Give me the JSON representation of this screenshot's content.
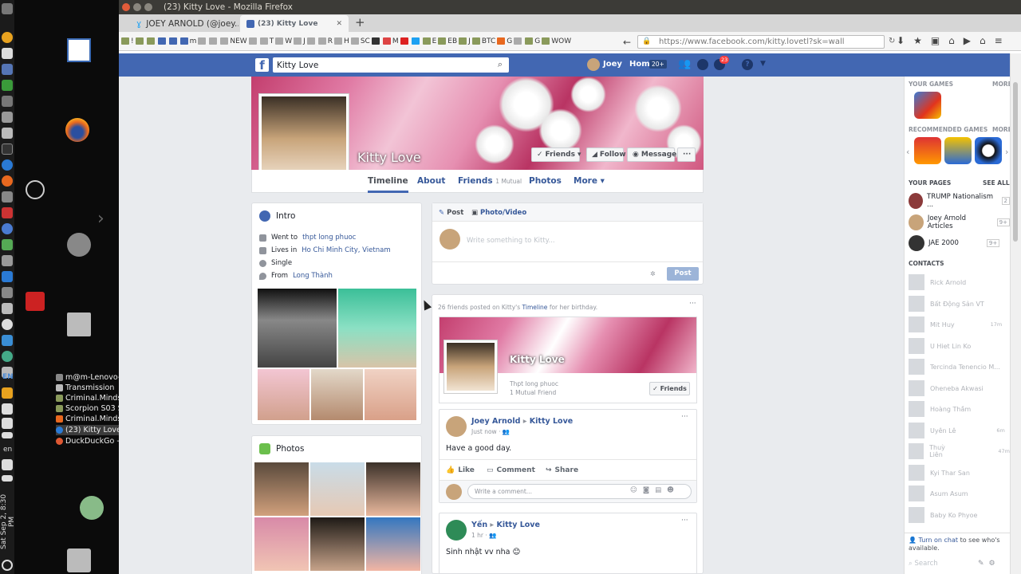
{
  "dock": {
    "lang": "EN",
    "lang2": "en",
    "clock": "Sat Sep 2, 8:30 PM"
  },
  "taskbar": [
    "m@m-Lenovo-...",
    "Transmission",
    "Criminal.Minds...",
    "Scorpion S03 S...",
    "Criminal.Minds...",
    "(23) Kitty Love ...",
    "DuckDuckGo - ..."
  ],
  "window": {
    "title": "(23) Kitty Love - Mozilla Firefox"
  },
  "tabs": [
    {
      "label": "JOEY ARNOLD (@joey..."
    },
    {
      "label": "(23) Kitty Love"
    }
  ],
  "bookmarks": [
    "!",
    "",
    "",
    "",
    "",
    "m",
    "",
    "",
    "NEW",
    "",
    "T",
    "W",
    "J",
    "",
    "R",
    "H",
    "SC",
    "",
    "M",
    "",
    "",
    "E",
    "EB",
    "J",
    "BTC",
    "G",
    "",
    "G",
    "WOW"
  ],
  "url": "https://www.facebook.com/kitty.lovetl?sk=wall",
  "fb": {
    "search_value": "Kitty Love",
    "user": "Joey",
    "home": "Home",
    "home_count": "20+",
    "notif_count": "23"
  },
  "profile": {
    "name": "Kitty Love",
    "buttons": {
      "friends": "Friends",
      "follow": "Follow",
      "message": "Message",
      "more": "···"
    },
    "nav": {
      "timeline": "Timeline",
      "about": "About",
      "friends": "Friends",
      "mutual": "1 Mutual",
      "photos": "Photos",
      "more": "More"
    }
  },
  "intro": {
    "title": "Intro",
    "went_pre": "Went to",
    "went": "thpt long phuoc",
    "lives_pre": "Lives in",
    "lives": "Ho Chi Minh City, Vietnam",
    "status": "Single",
    "from_pre": "From",
    "from": "Long Thành"
  },
  "photos": {
    "title": "Photos"
  },
  "composer": {
    "post": "Post",
    "photo": "Photo/Video",
    "placeholder": "Write something to Kitty...",
    "post_btn": "Post"
  },
  "birthday": {
    "pre": "26 friends posted on Kitty's",
    "timeline": "Timeline",
    "post": "for her birthday.",
    "name": "Kitty Love",
    "school": "Thpt long phuoc",
    "mutual": "1 Mutual Friend",
    "friends_btn": "Friends"
  },
  "post1": {
    "author": "Joey Arnold",
    "target": "Kitty Love",
    "time": "Just now",
    "text": "Have a good day.",
    "like": "Like",
    "comment": "Comment",
    "share": "Share",
    "comment_placeholder": "Write a comment..."
  },
  "post2": {
    "author": "Yến",
    "target": "Kitty Love",
    "time": "1 hr",
    "text": "Sinh nhật vv nha 😊"
  },
  "right": {
    "your_games": "YOUR GAMES",
    "more": "MORE",
    "recommended": "RECOMMENDED GAMES",
    "more2": "MORE",
    "your_pages": "YOUR PAGES",
    "see_all": "SEE ALL",
    "pages": [
      {
        "name": "TRUMP Nationalism ...",
        "count": "2"
      },
      {
        "name": "Joey Arnold Articles",
        "count": "9+"
      },
      {
        "name": "JAE 2000",
        "count": "9+"
      }
    ],
    "contacts_title": "CONTACTS",
    "contacts": [
      {
        "name": "Rick Arnold",
        "t": ""
      },
      {
        "name": "Bất Động Sản VT",
        "t": ""
      },
      {
        "name": "Mit Huy",
        "t": "17m"
      },
      {
        "name": "U Hiet Lin Ko",
        "t": ""
      },
      {
        "name": "Tercinda Tenencio M...",
        "t": ""
      },
      {
        "name": "Oheneba Akwasi",
        "t": ""
      },
      {
        "name": "Hoàng Thắm",
        "t": ""
      },
      {
        "name": "Uyên Lê",
        "t": "6m"
      },
      {
        "name": "Thuỳ Liên",
        "t": "47m"
      },
      {
        "name": "Kyi Thar San",
        "t": ""
      },
      {
        "name": "Asum Asum",
        "t": ""
      },
      {
        "name": "Baby Ko Phyoe",
        "t": ""
      }
    ],
    "turn_on": "Turn on chat",
    "turn_on_rest": "to see who's available.",
    "search": "Search"
  }
}
